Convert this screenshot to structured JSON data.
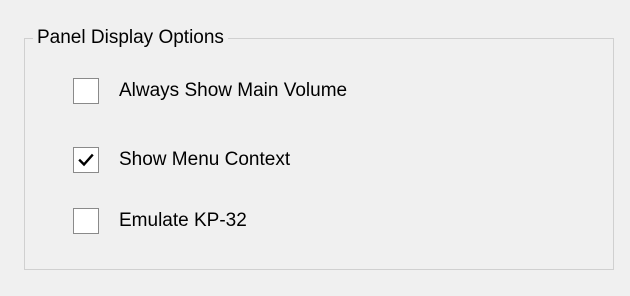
{
  "group": {
    "title": "Panel Display Options"
  },
  "options": [
    {
      "label": "Always Show Main Volume",
      "checked": false
    },
    {
      "label": "Show Menu Context",
      "checked": true
    },
    {
      "label": "Emulate KP-32",
      "checked": false
    }
  ]
}
